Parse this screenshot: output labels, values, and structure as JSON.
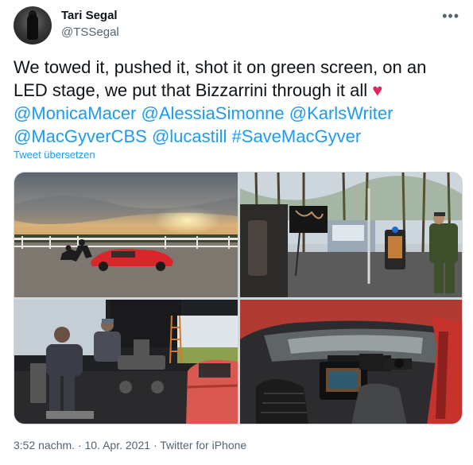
{
  "author": {
    "name": "Tari Segal",
    "handle": "@TSSegal"
  },
  "more_icon": "more-horizontal-icon",
  "tweet": {
    "line1": "We towed it, pushed it, shot it on green screen, on an",
    "line2": "LED stage, we put that Bizzarrini through it all",
    "heart": "♥",
    "mentions": [
      "@MonicaMacer",
      "@AlessiaSimonne",
      "@KarlsWriter",
      "@MacGyverCBS",
      "@lucastill"
    ],
    "hashtag": "#SaveMacGyver"
  },
  "translate_label": "Tweet übersetzen",
  "footer": {
    "time": "3:52 nachm.",
    "date": "10. Apr. 2021",
    "source": "Twitter for iPhone",
    "sep": "·"
  },
  "colors": {
    "link": "#1d9bf0",
    "secondary": "#536471",
    "heart": "#e0245e",
    "car_red": "#d9262b"
  }
}
